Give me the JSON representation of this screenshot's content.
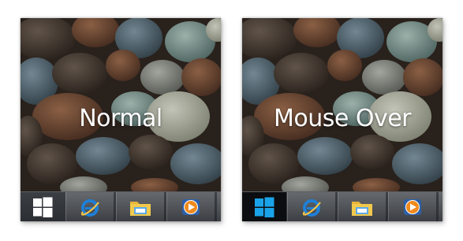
{
  "panels": [
    {
      "caption": "Normal",
      "start_state": "normal",
      "start_logo_color": "#ffffff"
    },
    {
      "caption": "Mouse Over",
      "start_state": "hover",
      "start_logo_color": "#1aa3e8"
    }
  ],
  "taskbar": {
    "pinned_icons": [
      "internet-explorer-icon",
      "file-explorer-icon",
      "media-player-icon"
    ]
  },
  "colors": {
    "taskbar_bg": "#2f3237",
    "hover_start_bg": "#0b0d10",
    "ie_blue": "#1f7fd6",
    "folder_yellow": "#f2c94c",
    "media_orange": "#f08a1c"
  }
}
